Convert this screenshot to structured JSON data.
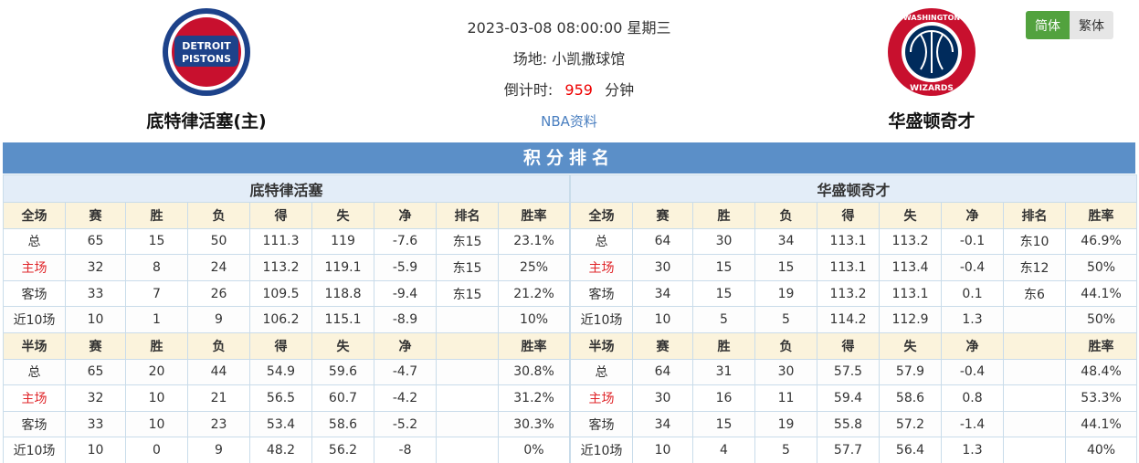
{
  "home_team": {
    "name": "底特律活塞(主)",
    "logo_text_top": "DETROIT",
    "logo_text_bottom": "PISTONS"
  },
  "away_team": {
    "name": "华盛顿奇才",
    "logo_text_top": "WASHINGTON",
    "logo_text_bottom": "WIZARDS"
  },
  "match": {
    "datetime": "2023-03-08 08:00:00 星期三",
    "venue_label": "场地:",
    "venue": "小凯撒球馆",
    "countdown_label": "倒计时:",
    "countdown_value": "959",
    "countdown_unit": "分钟",
    "nba_link": "NBA资料"
  },
  "lang": {
    "simplified": "简体",
    "traditional": "繁体"
  },
  "section_title": "积分排名",
  "tables": {
    "left": {
      "team": "底特律活塞",
      "full_header": [
        "全场",
        "赛",
        "胜",
        "负",
        "得",
        "失",
        "净",
        "排名",
        "胜率"
      ],
      "full_rows": [
        [
          "总",
          "65",
          "15",
          "50",
          "111.3",
          "119",
          "-7.6",
          "东15",
          "23.1%"
        ],
        [
          "主场",
          "32",
          "8",
          "24",
          "113.2",
          "119.1",
          "-5.9",
          "东15",
          "25%"
        ],
        [
          "客场",
          "33",
          "7",
          "26",
          "109.5",
          "118.8",
          "-9.4",
          "东15",
          "21.2%"
        ],
        [
          "近10场",
          "10",
          "1",
          "9",
          "106.2",
          "115.1",
          "-8.9",
          "",
          "10%"
        ]
      ],
      "half_header": [
        "半场",
        "赛",
        "胜",
        "负",
        "得",
        "失",
        "净",
        "",
        "胜率"
      ],
      "half_rows": [
        [
          "总",
          "65",
          "20",
          "44",
          "54.9",
          "59.6",
          "-4.7",
          "",
          "30.8%"
        ],
        [
          "主场",
          "32",
          "10",
          "21",
          "56.5",
          "60.7",
          "-4.2",
          "",
          "31.2%"
        ],
        [
          "客场",
          "33",
          "10",
          "23",
          "53.4",
          "58.6",
          "-5.2",
          "",
          "30.3%"
        ],
        [
          "近10场",
          "10",
          "0",
          "9",
          "48.2",
          "56.2",
          "-8",
          "",
          "0%"
        ]
      ]
    },
    "right": {
      "team": "华盛顿奇才",
      "full_header": [
        "全场",
        "赛",
        "胜",
        "负",
        "得",
        "失",
        "净",
        "排名",
        "胜率"
      ],
      "full_rows": [
        [
          "总",
          "64",
          "30",
          "34",
          "113.1",
          "113.2",
          "-0.1",
          "东10",
          "46.9%"
        ],
        [
          "主场",
          "30",
          "15",
          "15",
          "113.1",
          "113.4",
          "-0.4",
          "东12",
          "50%"
        ],
        [
          "客场",
          "34",
          "15",
          "19",
          "113.2",
          "113.1",
          "0.1",
          "东6",
          "44.1%"
        ],
        [
          "近10场",
          "10",
          "5",
          "5",
          "114.2",
          "112.9",
          "1.3",
          "",
          "50%"
        ]
      ],
      "half_header": [
        "半场",
        "赛",
        "胜",
        "负",
        "得",
        "失",
        "净",
        "",
        "胜率"
      ],
      "half_rows": [
        [
          "总",
          "64",
          "31",
          "30",
          "57.5",
          "57.9",
          "-0.4",
          "",
          "48.4%"
        ],
        [
          "主场",
          "30",
          "16",
          "11",
          "59.4",
          "58.6",
          "0.8",
          "",
          "53.3%"
        ],
        [
          "客场",
          "34",
          "15",
          "19",
          "55.8",
          "57.2",
          "-1.4",
          "",
          "44.1%"
        ],
        [
          "近10场",
          "10",
          "4",
          "5",
          "57.7",
          "56.4",
          "1.3",
          "",
          "40%"
        ]
      ]
    }
  },
  "colors": {
    "title_bar": "#5b8fc8",
    "home_row_label": "#e0262a",
    "active_lang": "#52a23e",
    "countdown": "#e00000"
  }
}
